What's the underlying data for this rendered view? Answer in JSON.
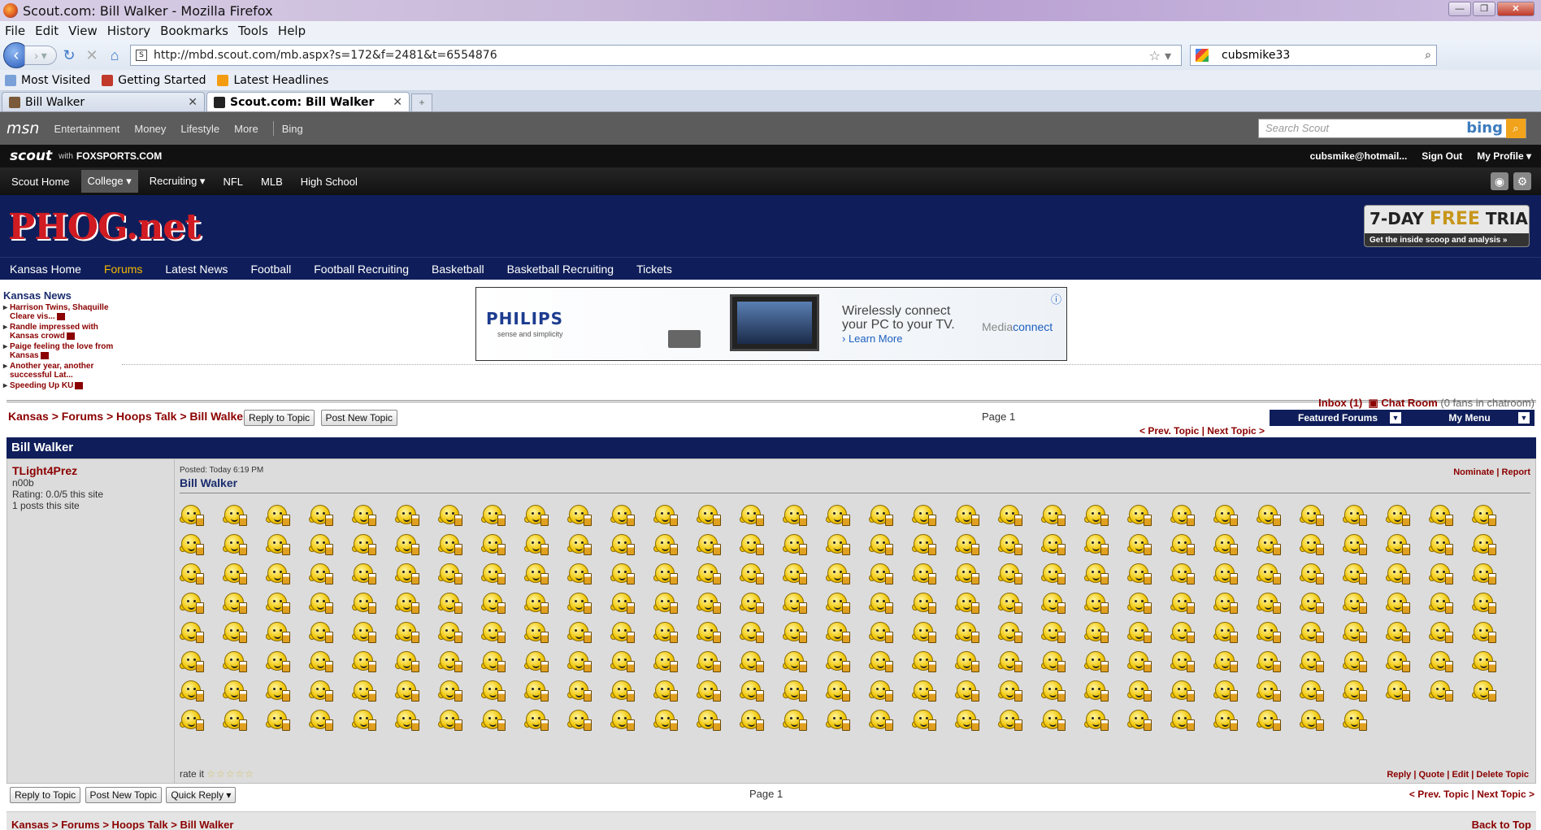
{
  "window": {
    "title": "Scout.com: Bill Walker - Mozilla Firefox"
  },
  "menu": [
    "File",
    "Edit",
    "View",
    "History",
    "Bookmarks",
    "Tools",
    "Help"
  ],
  "urlbar": {
    "url": "http://mbd.scout.com/mb.aspx?s=172&f=2481&t=6554876"
  },
  "searchbar": {
    "value": "cubsmike33"
  },
  "bookmarks": [
    "Most Visited",
    "Getting Started",
    "Latest Headlines"
  ],
  "tabs": [
    {
      "label": "Bill Walker",
      "active": false
    },
    {
      "label": "Scout.com: Bill Walker",
      "active": true
    }
  ],
  "msn": {
    "logo": "msn",
    "links": [
      "Entertainment",
      "Money",
      "Lifestyle",
      "More",
      "Bing"
    ],
    "search_placeholder": "Search Scout",
    "search_brand": "bing"
  },
  "scout": {
    "logo": "scout",
    "with": "with",
    "partner": "FOXSPORTS.COM",
    "user": "cubsmike@hotmail...",
    "signout": "Sign Out",
    "profile": "My Profile ▾",
    "nav": [
      "Scout Home",
      "College ▾",
      "Recruiting ▾",
      "NFL",
      "MLB",
      "High School"
    ]
  },
  "site": {
    "logo": "PHOG.net",
    "trial_line1_a": "7-DAY",
    "trial_line1_b": "FREE",
    "trial_line1_c": "TRIAL",
    "trial_line2": "Get the inside scoop and analysis »",
    "nav": [
      "Kansas Home",
      "Forums",
      "Latest News",
      "Football",
      "Football Recruiting",
      "Basketball",
      "Basketball Recruiting",
      "Tickets"
    ]
  },
  "news": {
    "heading": "Kansas News",
    "items": [
      "Harrison Twins, Shaquille Cleare vis...",
      "Randle impressed with Kansas crowd",
      "Paige feeling the love from Kansas",
      "Another year, another successful Lat...",
      "Speeding Up KU"
    ]
  },
  "ad": {
    "brand": "PHILIPS",
    "tagline": "sense and simplicity",
    "copy1": "Wirelessly connect",
    "copy2": "your PC to your TV.",
    "learn": "› Learn More",
    "product_a": "Media",
    "product_b": "connect"
  },
  "chat": {
    "inbox": "Inbox (1)",
    "chatroom": "Chat Room",
    "fans": "(0 fans in chatroom)"
  },
  "topic": {
    "crumbs": "Kansas > Forums > Hoops Talk > Bill Walker",
    "reply_btn": "Reply to Topic",
    "new_btn": "Post New Topic",
    "page": "Page 1",
    "prevnext": "< Prev. Topic | Next Topic >",
    "featured": "Featured Forums",
    "mymenu": "My Menu",
    "title": "Bill Walker"
  },
  "post": {
    "author": "TLight4Prez",
    "rank": "n00b",
    "rating": "Rating: 0.0/5 this site",
    "posts": "1 posts this site",
    "posted": "Posted: Today 6:19 PM",
    "title": "Bill Walker",
    "tools": "Nominate | Report",
    "smiley_count": 245,
    "smiley_icon": "beer-smiley-icon",
    "rate": "rate it",
    "stars": "☆☆☆☆☆",
    "footer_tools": "Reply | Quote | Edit | Delete Topic"
  },
  "bottom": {
    "reply_btn": "Reply to Topic",
    "new_btn": "Post New Topic",
    "quick_btn": "Quick Reply ▾",
    "page": "Page 1",
    "prevnext": "< Prev. Topic | Next Topic >",
    "crumbs": "Kansas > Forums > Hoops Talk > Bill Walker",
    "back_to_top": "Back to Top"
  }
}
